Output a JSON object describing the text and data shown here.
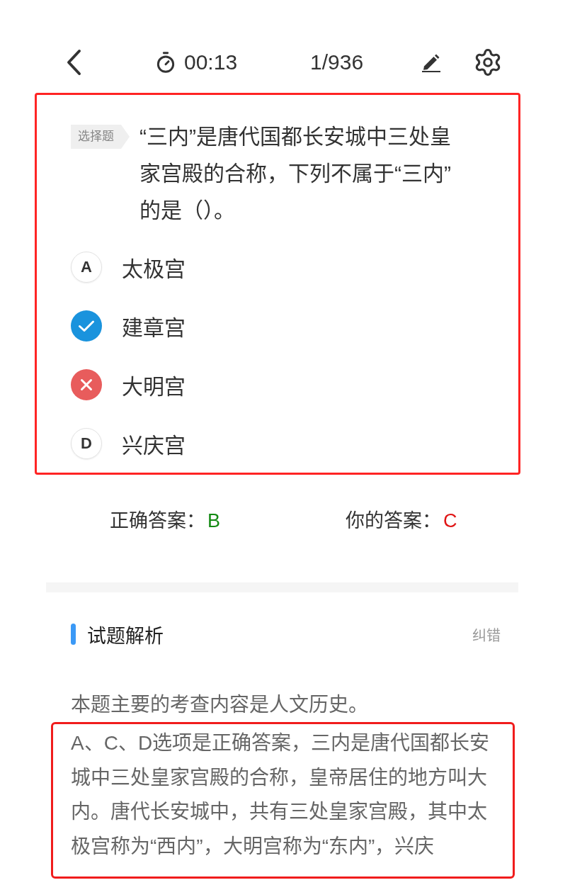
{
  "top_bar": {
    "timer": "00:13",
    "progress": "1/936"
  },
  "question": {
    "highlighted": true,
    "type_tag": "选择题",
    "text": "“三内”是唐代国都长安城中三处皇家宫殿的合称，下列不属于“三内”的是（）。",
    "options": [
      {
        "kind": "letter",
        "letter": "A",
        "text": "太极宫"
      },
      {
        "kind": "correct",
        "text": "建章宫"
      },
      {
        "kind": "wrong",
        "text": "大明宫"
      },
      {
        "kind": "letter",
        "letter": "D",
        "text": "兴庆宫"
      }
    ]
  },
  "answers": [
    {
      "label": "正确答案：",
      "value": "B",
      "color": "#138a13"
    },
    {
      "label": "你的答案：",
      "value": "C",
      "color": "#e01414"
    }
  ],
  "analysis": {
    "title": "试题解析",
    "action": "纠错",
    "paragraphs": [
      {
        "text": "本题主要的考查内容是人文历史。",
        "highlighted": false
      },
      {
        "text": "A、C、D选项是正确答案，三内是唐代国都长安城中三处皇家宫殿的合称，皇帝居住的地方叫大内。唐代长安城中，共有三处皇家宫殿，其中太极宫称为“西内”，大明宫称为“东内”，兴庆",
        "highlighted": true
      }
    ]
  }
}
